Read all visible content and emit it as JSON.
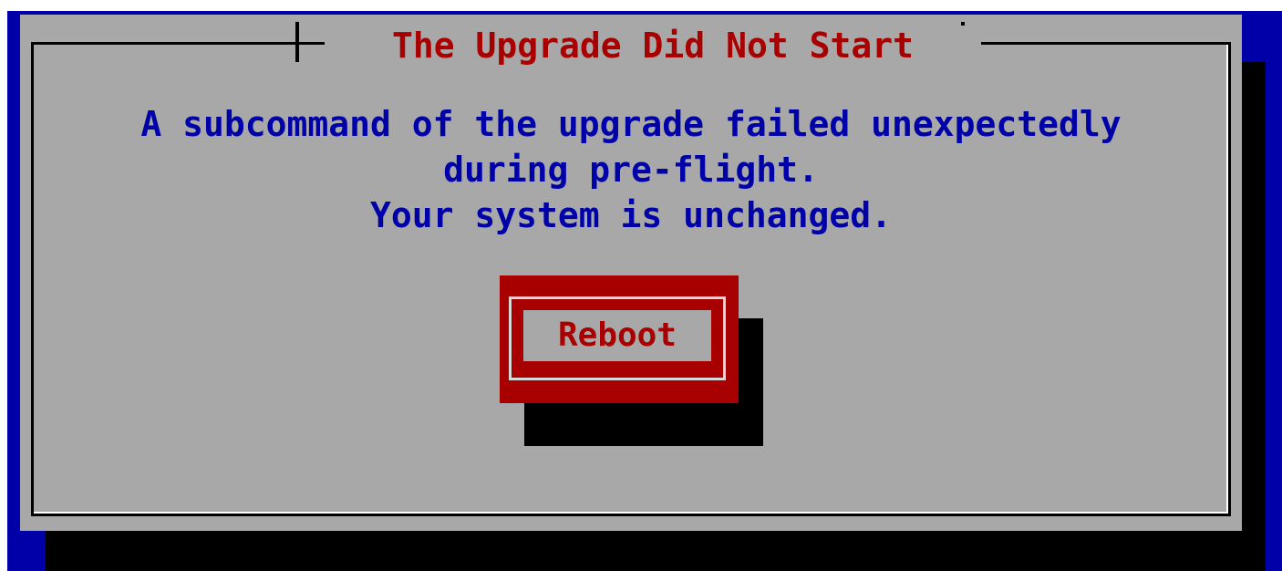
{
  "dialog": {
    "title": "The Upgrade Did Not Start",
    "message_lines": [
      "A subcommand of the upgrade failed unexpectedly",
      "during pre-flight.",
      "Your system is unchanged."
    ]
  },
  "buttons": {
    "reboot_label": "Reboot"
  },
  "colors": {
    "background": "#0000a8",
    "dialog": "#a8a8a8",
    "title_text": "#a80000",
    "message_text": "#0000a8",
    "button": "#a80000",
    "shadow": "#000000"
  }
}
